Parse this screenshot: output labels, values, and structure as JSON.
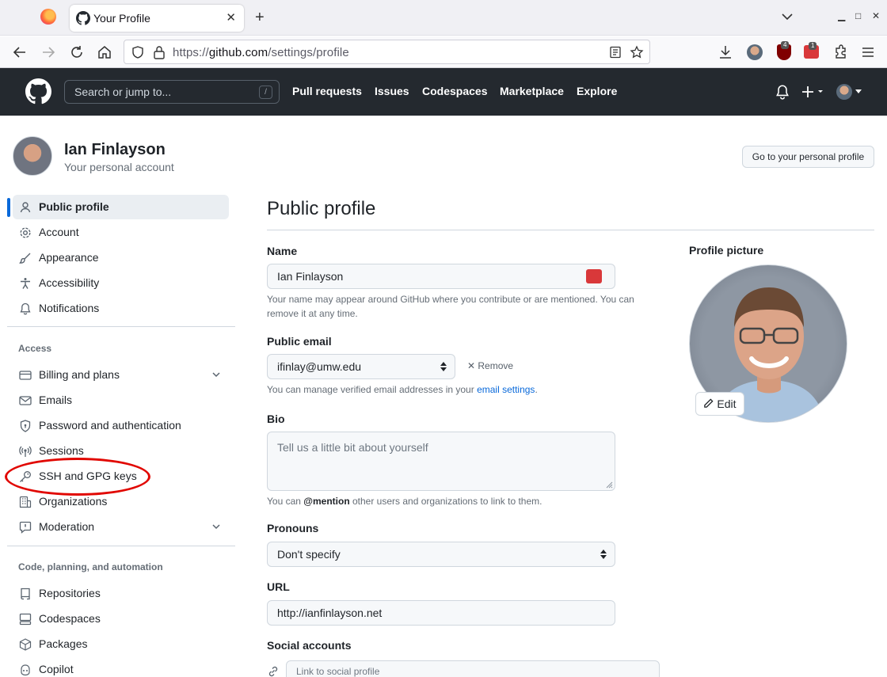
{
  "browser": {
    "tab_title": "Your Profile",
    "url_prefix": "https://",
    "url_host": "github.com",
    "url_path": "/settings/profile",
    "badge_ublock": "4",
    "badge_pm": "1"
  },
  "header": {
    "search_placeholder": "Search or jump to...",
    "slash": "/",
    "nav": [
      "Pull requests",
      "Issues",
      "Codespaces",
      "Marketplace",
      "Explore"
    ]
  },
  "account": {
    "name": "Ian Finlayson",
    "subtitle": "Your personal account",
    "profile_button": "Go to your personal profile"
  },
  "sidebar": {
    "items": [
      {
        "label": "Public profile",
        "icon": "person-icon"
      },
      {
        "label": "Account",
        "icon": "gear-icon"
      },
      {
        "label": "Appearance",
        "icon": "paintbrush-icon"
      },
      {
        "label": "Accessibility",
        "icon": "accessibility-icon"
      },
      {
        "label": "Notifications",
        "icon": "bell-icon"
      }
    ],
    "access_heading": "Access",
    "access_items": [
      {
        "label": "Billing and plans",
        "icon": "credit-card-icon"
      },
      {
        "label": "Emails",
        "icon": "mail-icon"
      },
      {
        "label": "Password and authentication",
        "icon": "shield-icon"
      },
      {
        "label": "Sessions",
        "icon": "broadcast-icon"
      },
      {
        "label": "SSH and GPG keys",
        "icon": "key-icon"
      },
      {
        "label": "Organizations",
        "icon": "organization-icon"
      },
      {
        "label": "Moderation",
        "icon": "report-icon"
      }
    ],
    "code_heading": "Code, planning, and automation",
    "code_items": [
      {
        "label": "Repositories",
        "icon": "repo-icon"
      },
      {
        "label": "Codespaces",
        "icon": "codespaces-icon"
      },
      {
        "label": "Packages",
        "icon": "package-icon"
      },
      {
        "label": "Copilot",
        "icon": "copilot-icon"
      }
    ]
  },
  "main": {
    "title": "Public profile",
    "name_label": "Name",
    "name_value": "Ian Finlayson",
    "name_note_1": "Your name may appear around GitHub where you contribute or are mentioned. You can",
    "name_note_2": "remove it at any time.",
    "email_label": "Public email",
    "email_value": "ifinlay@umw.edu",
    "remove_label": "Remove",
    "email_note": "You can manage verified email addresses in your",
    "email_link": "email settings",
    "email_note_end": ".",
    "bio_label": "Bio",
    "bio_placeholder": "Tell us a little bit about yourself",
    "bio_note_pre": "You can",
    "bio_note_mention": "@mention",
    "bio_note_post": "other users and organizations to link to them.",
    "pronouns_label": "Pronouns",
    "pronouns_value": "Don't specify",
    "url_label": "URL",
    "url_value": "http://ianfinlayson.net",
    "social_label": "Social accounts",
    "social_placeholder": "Link to social profile",
    "picture_label": "Profile picture",
    "edit_label": "Edit"
  }
}
